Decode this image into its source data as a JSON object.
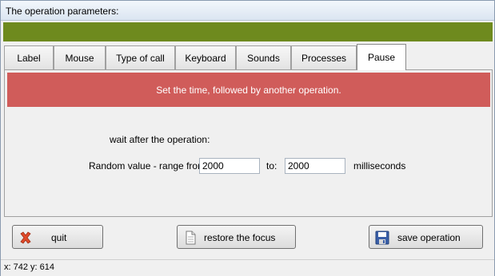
{
  "window": {
    "title": "The operation parameters:"
  },
  "tabs": [
    {
      "label": "Label"
    },
    {
      "label": "Mouse"
    },
    {
      "label": "Type of call"
    },
    {
      "label": "Keyboard"
    },
    {
      "label": "Sounds"
    },
    {
      "label": "Processes"
    },
    {
      "label": "Pause",
      "active": true
    }
  ],
  "banner": {
    "text": "Set the time, followed by another operation."
  },
  "pause": {
    "wait_label": "wait after the operation:",
    "range_label": "Random value - range from:",
    "from_value": "2000",
    "to_label": "to:",
    "to_value": "2000",
    "unit_label": "milliseconds"
  },
  "buttons": {
    "quit": {
      "label": "quit",
      "icon": "red-x-icon"
    },
    "restore": {
      "label": "restore the focus",
      "icon": "document-icon"
    },
    "save": {
      "label": "save operation",
      "icon": "floppy-disk-icon"
    }
  },
  "status": {
    "coords": "x: 742  y: 614"
  },
  "colors": {
    "header_bar": "#6e8a1e",
    "banner_bg": "#d05c5a",
    "banner_text": "#ffffff"
  }
}
